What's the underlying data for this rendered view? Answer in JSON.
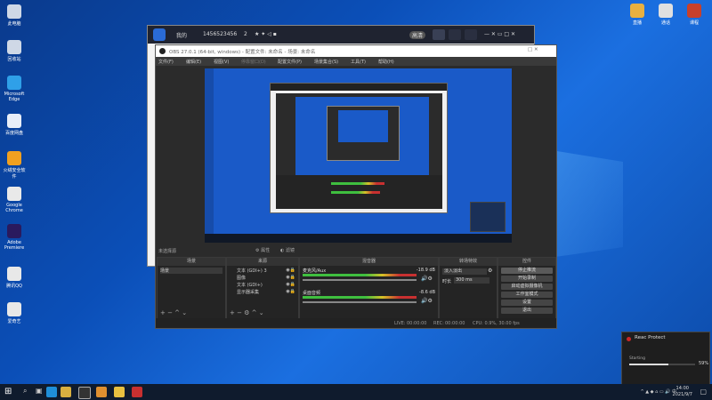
{
  "desktop": {
    "icons_left": [
      {
        "label": "此电脑",
        "color": "#cfd8e6"
      },
      {
        "label": "回收站",
        "color": "#cfd8e6"
      },
      {
        "label": "Microsoft Edge",
        "color": "#2fa0e8"
      },
      {
        "label": "百度网盘",
        "color": "#e8eef8"
      },
      {
        "label": "火绒安全软件",
        "color": "#f0a020"
      },
      {
        "label": "Google Chrome",
        "color": "#e9e9e9"
      },
      {
        "label": "Adobe Premiere",
        "color": "#2a1a5e"
      },
      {
        "label": "腾讯QQ",
        "color": "#e8e8e8"
      },
      {
        "label": "爱奇艺",
        "color": "#e8e8e8"
      }
    ],
    "icons_right": [
      {
        "label": "直播",
        "color": "#e8b040"
      },
      {
        "label": "通话",
        "color": "#e0e0e0"
      },
      {
        "label": "课程",
        "color": "#c8402a"
      }
    ]
  },
  "remote_bar": {
    "title": "我的",
    "device_id": "1456523456",
    "user_count": "2",
    "quality_badge": "高清"
  },
  "obs": {
    "title": "OBS 27.0.1 (64-bit, windows) - 配置文件: 未命名 - 场景: 未命名",
    "menu": [
      "文件(F)",
      "编辑(E)",
      "视图(V)",
      "停靠窗口(D)",
      "配置文件(P)",
      "场景集合(S)",
      "工具(T)",
      "帮助(H)"
    ],
    "no_source_selected": "未选择源",
    "properties_label": "属性",
    "filters_label": "滤镜",
    "panels": {
      "scenes": {
        "title": "场景",
        "items": [
          "场景"
        ]
      },
      "sources": {
        "title": "来源",
        "items": [
          "文本 (GDI+) 3",
          "图像",
          "文本 (GDI+)",
          "显示器采集"
        ]
      },
      "mixer": {
        "title": "混音器",
        "tracks": [
          {
            "name": "麦克风/Aux",
            "db": "-18.9 dB"
          },
          {
            "name": "桌面音频",
            "db": "-8.6 dB"
          }
        ]
      },
      "transitions": {
        "title": "转场特效",
        "type": "淡入淡出",
        "duration_label": "时长",
        "duration_value": "300 ms"
      },
      "controls": {
        "title": "控件",
        "buttons": [
          "停止推流",
          "开始录制",
          "启动虚拟摄像机",
          "工作室模式",
          "设置",
          "退出"
        ]
      }
    },
    "status": {
      "live_label": "LIVE:",
      "live_time": "00:00:00",
      "rec_label": "REC:",
      "rec_time": "00:00:00",
      "cpu": "CPU: 0.9%, 30.00 fps"
    }
  },
  "toast": {
    "title": "Reac Protect",
    "status": "Starting",
    "percent": "59%",
    "progress": 0.59
  },
  "taskbar": {
    "time": "14:00",
    "date": "2021/9/7"
  }
}
